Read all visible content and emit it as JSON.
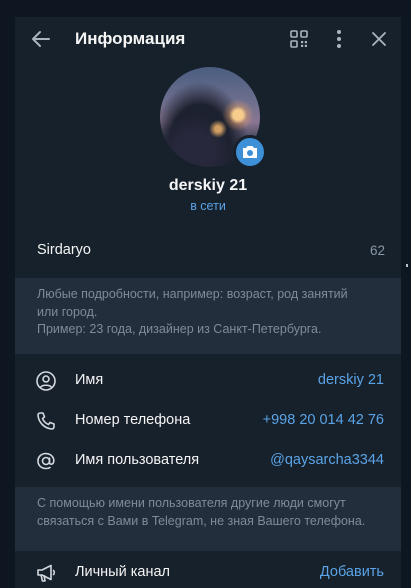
{
  "header": {
    "title": "Информация"
  },
  "profile": {
    "name": "derskiy 21",
    "status": "в сети"
  },
  "bio": {
    "text": "Sirdaryo",
    "remaining": "62"
  },
  "bio_hint": {
    "line1": "Любые подробности, например: возраст, род занятий",
    "line2": "или город.",
    "line3": "Пример: 23 года, дизайнер из Санкт-Петербурга."
  },
  "rows": {
    "name": {
      "label": "Имя",
      "value": "derskiy 21",
      "icon": "person-icon"
    },
    "phone": {
      "label": "Номер телефона",
      "value": "+998 20 014 42 76",
      "icon": "phone-icon"
    },
    "username": {
      "label": "Имя пользователя",
      "value": "@qaysarcha3344",
      "icon": "at-icon"
    },
    "channel": {
      "label": "Личный канал",
      "value": "Добавить",
      "icon": "megaphone-icon"
    }
  },
  "username_hint": {
    "line1": "С помощью имени пользователя другие люди смогут",
    "line2": "связаться с Вами в Telegram, не зная Вашего телефона."
  },
  "colors": {
    "panel_bg": "#17212b",
    "hint_bg": "#232e3c",
    "accent": "#5aa3e6",
    "camera_bg": "#3d8fd6"
  }
}
